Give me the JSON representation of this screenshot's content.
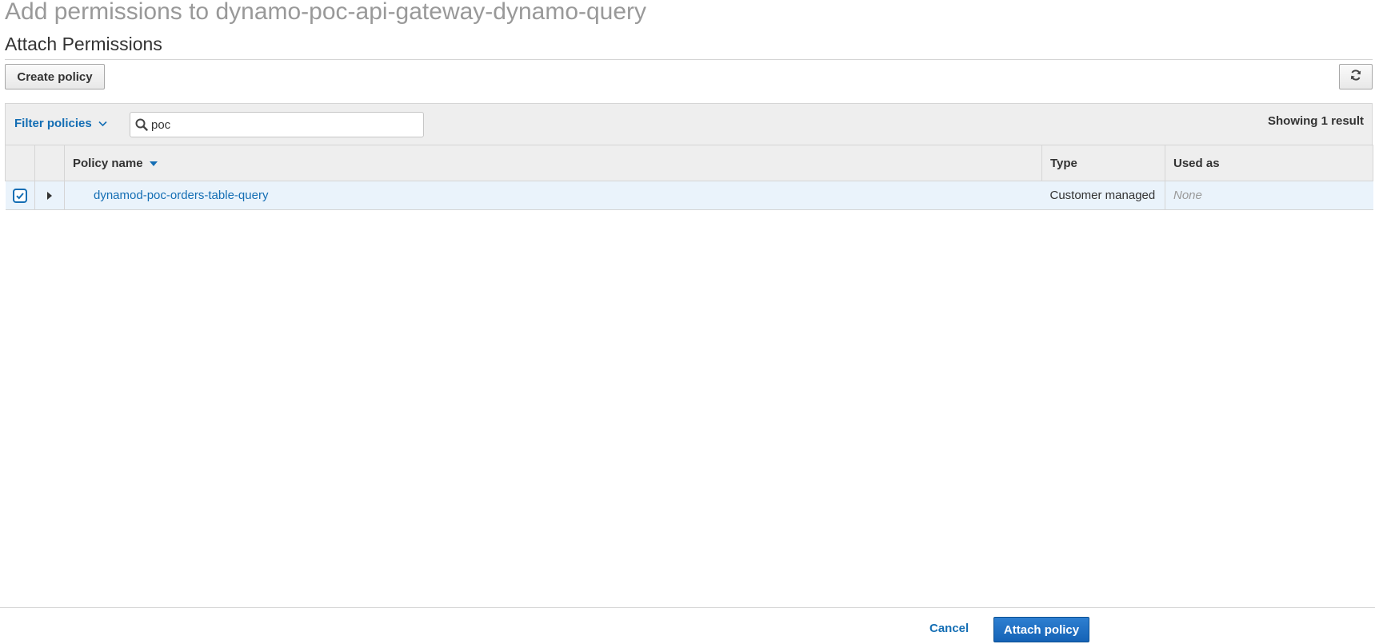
{
  "header": {
    "title": "Add permissions to dynamo-poc-api-gateway-dynamo-query",
    "subtitle": "Attach Permissions"
  },
  "toolbar": {
    "create_policy_label": "Create policy",
    "refresh_icon": "refresh-icon"
  },
  "filter": {
    "toggle_label": "Filter policies",
    "search_value": "poc",
    "result_count": "Showing 1 result"
  },
  "table": {
    "columns": [
      "Policy name",
      "Type",
      "Used as"
    ],
    "sort_column": "Policy name",
    "rows": [
      {
        "selected": true,
        "policy_name": "dynamod-poc-orders-table-query",
        "type": "Customer managed",
        "used_as": "None"
      }
    ]
  },
  "footer": {
    "cancel_label": "Cancel",
    "attach_label": "Attach policy"
  },
  "colors": {
    "link": "#146eb4",
    "primary_button": "#1a6bc0",
    "selected_row": "#eaf3fb",
    "header_bg": "#eeeeee"
  }
}
